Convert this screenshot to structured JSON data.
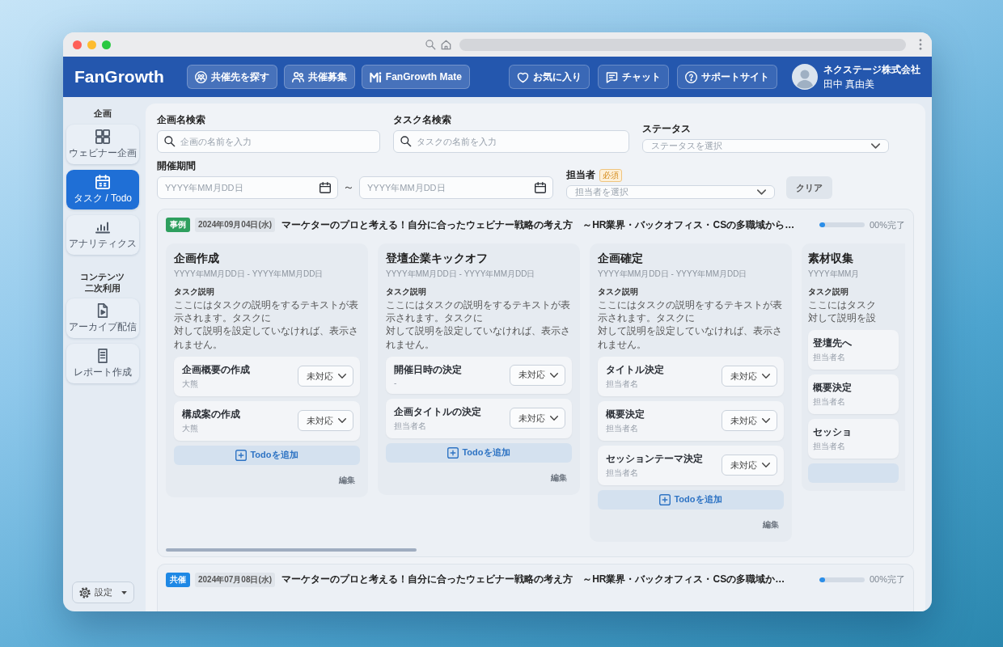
{
  "header": {
    "logo": "FanGrowth",
    "nav": [
      "共催先を探す",
      "共催募集",
      "FanGrowth Mate"
    ],
    "links": [
      "お気に入り",
      "チャット",
      "サポートサイト"
    ],
    "user": {
      "company": "ネクステージ株式会社",
      "name": "田中 真由美"
    }
  },
  "sidebar": {
    "sections": [
      {
        "title": "企画",
        "items": [
          {
            "label": "ウェビナー企画",
            "selected": false
          },
          {
            "label": "タスク / Todo",
            "selected": true
          },
          {
            "label": "アナリティクス",
            "selected": false
          }
        ]
      },
      {
        "title": "コンテンツ二次利用",
        "items": [
          {
            "label": "アーカイブ配信",
            "selected": false
          },
          {
            "label": "レポート作成",
            "selected": false
          }
        ]
      }
    ],
    "settings": "設定"
  },
  "filters": {
    "project_search": {
      "label": "企画名検索",
      "placeholder": "企画の名前を入力"
    },
    "task_search": {
      "label": "タスク名検索",
      "placeholder": "タスクの名前を入力"
    },
    "status": {
      "label": "ステータス",
      "placeholder": "ステータスを選択"
    },
    "period": {
      "label": "開催期間",
      "from": {
        "placeholder": "YYYY年MM月DD日"
      },
      "separator": "～",
      "to": {
        "placeholder": "YYYY年MM月DD日"
      }
    },
    "assignee": {
      "label": "担当者",
      "required_badge": "必須",
      "placeholder": "担当者を選択"
    },
    "clear_button": "クリア"
  },
  "projects": [
    {
      "badge": {
        "label": "事例",
        "color": "#2e9f5e"
      },
      "date": "2024年09月04日(水)",
      "title": "マーケターのプロと考える！自分に合ったウェビナー戦略の考え方　～HR業界・バックオフィス・CSの多職域から…",
      "level": 0.12,
      "progress_text": "00%完了",
      "columns": [
        {
          "title": "企画作成",
          "period": "YYYY年MM月DD日 - YYYY年MM月DD日",
          "description_label": "タスク説明",
          "description_lines": [
            "ここにはタスクの説明をするテキストが表示されます。タスクに",
            "対して説明を設定していなければ、表示されません。"
          ],
          "todos": [
            {
              "title": "企画概要の作成",
              "assignee": "大熊",
              "status": "未対応"
            },
            {
              "title": "構成案の作成",
              "assignee": "大熊",
              "status": "未対応"
            }
          ],
          "add_button": "Todoを追加",
          "edit_link": "編集"
        },
        {
          "title": "登壇企業キックオフ",
          "period": "YYYY年MM月DD日 - YYYY年MM月DD日",
          "description_label": "タスク説明",
          "description_lines": [
            "ここにはタスクの説明をするテキストが表示されます。タスクに",
            "対して説明を設定していなければ、表示されません。"
          ],
          "todos": [
            {
              "title": "開催日時の決定",
              "assignee": "-",
              "status": "未対応"
            },
            {
              "title": "企画タイトルの決定",
              "assignee": "担当者名",
              "status": "未対応"
            }
          ],
          "add_button": "Todoを追加",
          "edit_link": "編集"
        },
        {
          "title": "企画確定",
          "period": "YYYY年MM月DD日 - YYYY年MM月DD日",
          "description_label": "タスク説明",
          "description_lines": [
            "ここにはタスクの説明をするテキストが表示されます。タスクに",
            "対して説明を設定していなければ、表示されません。"
          ],
          "todos": [
            {
              "title": "タイトル決定",
              "assignee": "担当者名",
              "status": "未対応"
            },
            {
              "title": "概要決定",
              "assignee": "担当者名",
              "status": "未対応"
            },
            {
              "title": "セッションテーマ決定",
              "assignee": "担当者名",
              "status": "未対応"
            }
          ],
          "add_button": "Todoを追加",
          "edit_link": "編集"
        },
        {
          "title": "素材収集",
          "period": "YYYY年MM月",
          "description_label": "タスク説明",
          "description_lines": [
            "ここにはタスク",
            "対して説明を設"
          ],
          "todos": [
            {
              "title": "登壇先へ",
              "assignee": "担当者名"
            },
            {
              "title": "概要決定",
              "assignee": "担当者名"
            },
            {
              "title": "セッショ",
              "assignee": "担当者名"
            }
          ]
        }
      ]
    },
    {
      "badge": {
        "label": "共催",
        "color": "#1e88e5"
      },
      "date": "2024年07月08日(水)",
      "title": "マーケターのプロと考える！自分に合ったウェビナー戦略の考え方　～HR業界・バックオフィス・CSの多職域か…",
      "level": 0.12,
      "progress_text": "00%完了"
    }
  ]
}
